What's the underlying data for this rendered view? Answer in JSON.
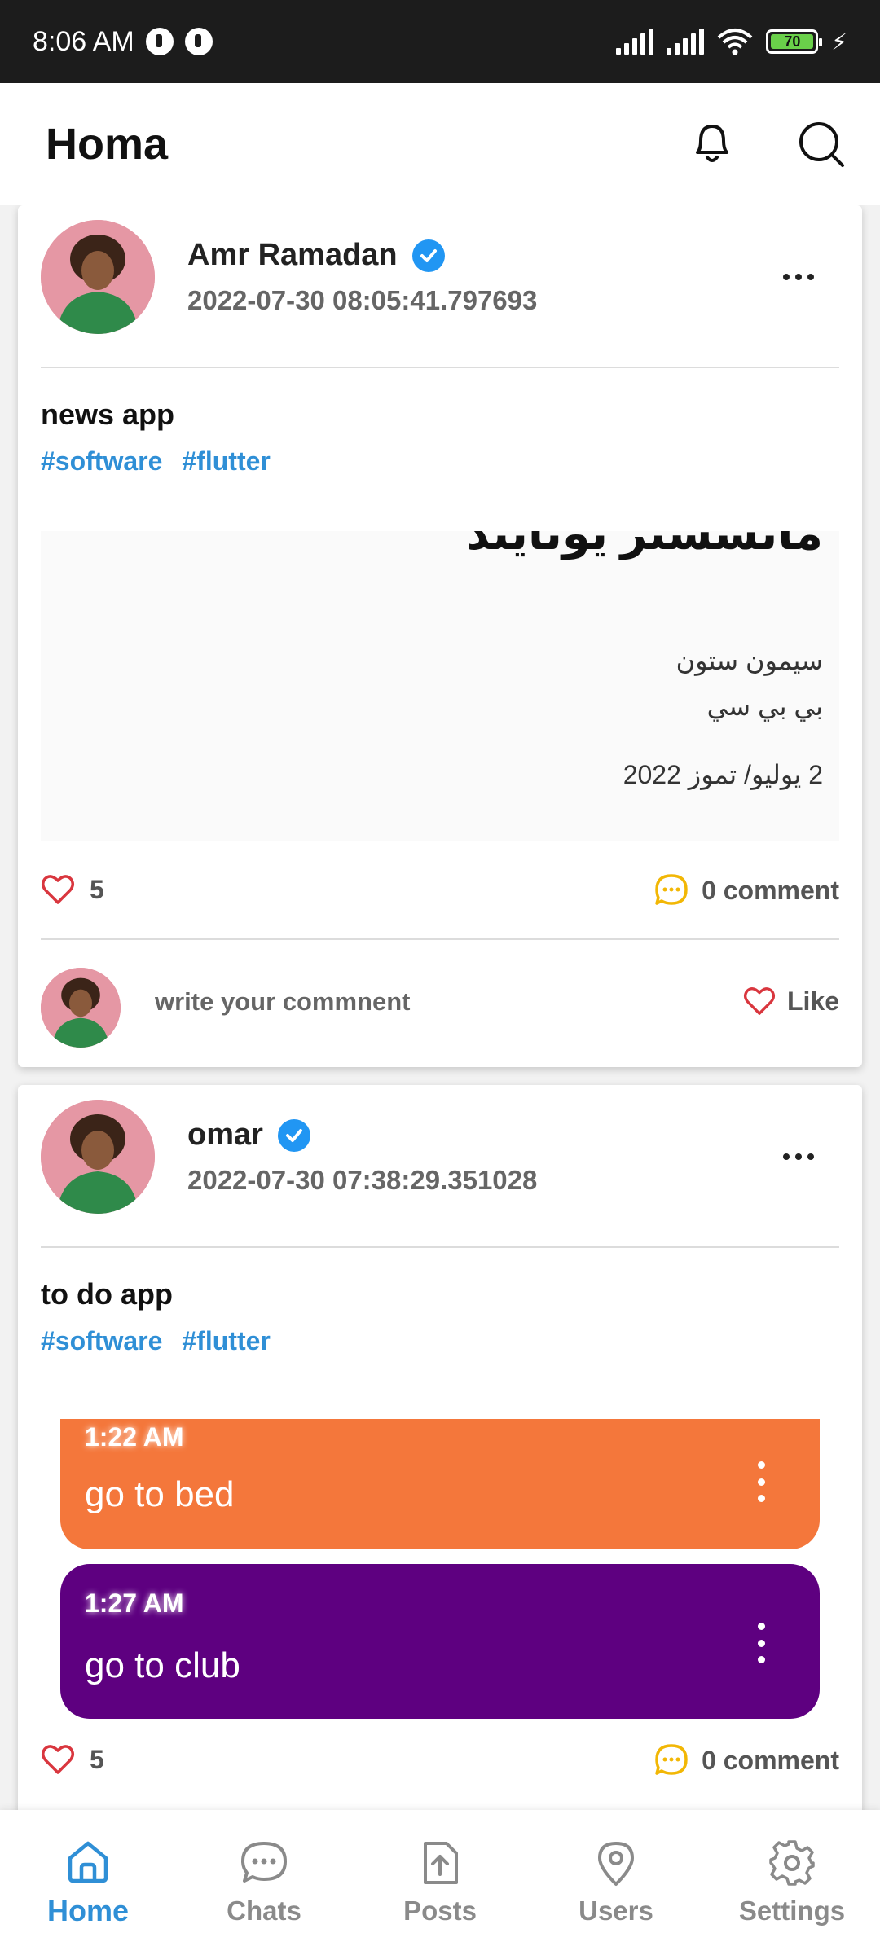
{
  "status_bar": {
    "time": "8:06 AM",
    "battery": "70"
  },
  "app_bar": {
    "title": "Homa",
    "icons": [
      "bell-icon",
      "search-icon"
    ]
  },
  "posts": [
    {
      "author": "Amr Ramadan",
      "timestamp": "2022-07-30 08:05:41.797693",
      "title": "news app",
      "tags": [
        "#software",
        "#flutter"
      ],
      "preview": {
        "headline": "مانشستر يونايتد",
        "author": "سيمون ستون",
        "source": "بي بي سي",
        "date": "2 يوليو/ تموز 2022"
      },
      "likes": "5",
      "comments": "0 comment",
      "comment_placeholder": "write your commnent",
      "like_label": "Like"
    },
    {
      "author": "omar",
      "timestamp": "2022-07-30 07:38:29.351028",
      "title": "to do app",
      "tags": [
        "#software",
        "#flutter"
      ],
      "tasks": [
        {
          "time": "1:22 AM",
          "text": "go to bed",
          "color": "#f4773b"
        },
        {
          "time": "1:27 AM",
          "text": "go to club",
          "color": "#5e0080"
        }
      ],
      "likes": "5",
      "comments": "0 comment"
    }
  ],
  "bottom_nav": [
    {
      "label": "Home",
      "icon": "home-icon",
      "active": true
    },
    {
      "label": "Chats",
      "icon": "chat-icon",
      "active": false
    },
    {
      "label": "Posts",
      "icon": "upload-file-icon",
      "active": false
    },
    {
      "label": "Users",
      "icon": "location-pin-icon",
      "active": false
    },
    {
      "label": "Settings",
      "icon": "gear-icon",
      "active": false
    }
  ],
  "colors": {
    "accent": "#2f8fd6",
    "like_red": "#d9363e",
    "comment_yellow": "#f2b705"
  }
}
